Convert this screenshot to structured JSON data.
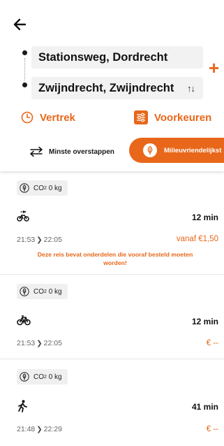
{
  "header": {
    "from": "Stationsweg, Dordrecht",
    "to": "Zwijndrecht, Zwijndrecht",
    "swap_symbol": "↑↓",
    "add_symbol": "+",
    "departure_label": "Vertrek",
    "preferences_label": "Voorkeuren"
  },
  "sort": {
    "fewest_transfers_label": "Minste overstappen",
    "eco_label": "Milieuvriendelijkst"
  },
  "trips": [
    {
      "co2_prefix": "CO",
      "co2_sub": "2",
      "co2_value": "0 kg",
      "mode_icon": "bike-share-icon",
      "duration": "12 min",
      "depart": "21:53",
      "arrive": "22:05",
      "price": "vanaf €1,50",
      "warning": "Deze reis bevat onderdelen die vooraf besteld moeten worden!"
    },
    {
      "co2_prefix": "CO",
      "co2_sub": "2",
      "co2_value": "0 kg",
      "mode_icon": "bike-icon",
      "duration": "12 min",
      "depart": "21:53",
      "arrive": "22:05",
      "price": "€ --"
    },
    {
      "co2_prefix": "CO",
      "co2_sub": "2",
      "co2_value": "0 kg",
      "mode_icon": "walk-icon",
      "duration": "41 min",
      "depart": "21:48",
      "arrive": "22:29",
      "price": "€ --"
    }
  ],
  "colors": {
    "accent": "#e8671a",
    "field_bg": "#f2f2f2",
    "badge_bg": "#f0f0f0"
  }
}
